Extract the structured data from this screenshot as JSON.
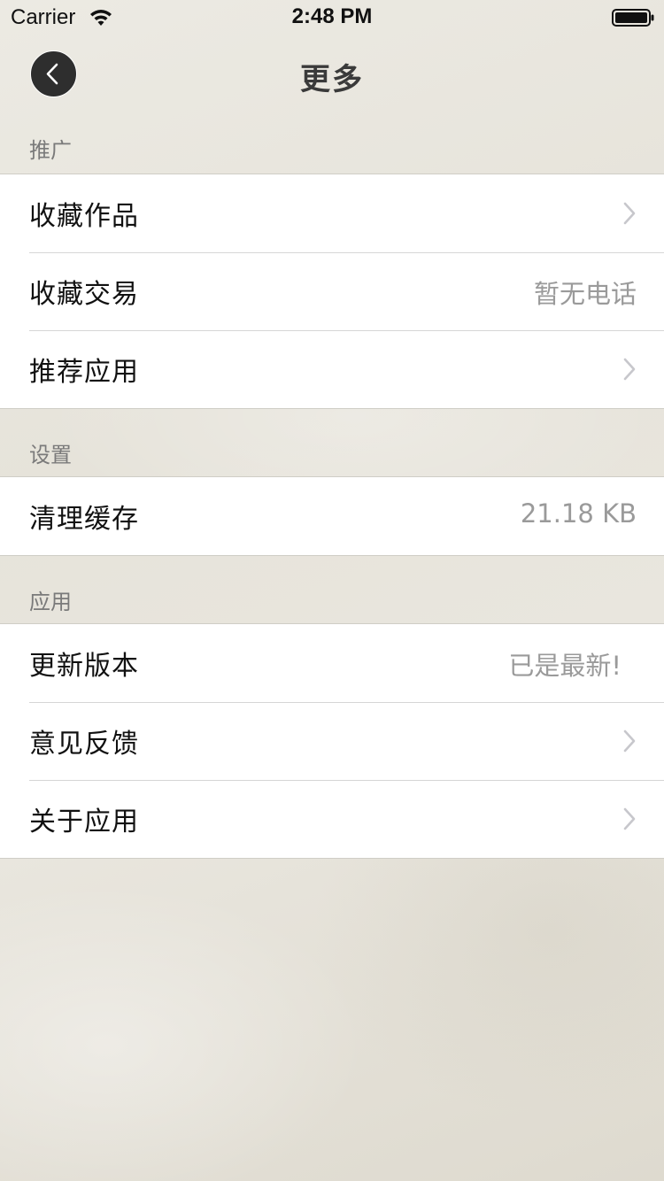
{
  "status_bar": {
    "carrier": "Carrier",
    "time": "2:48 PM",
    "wifi_icon": "wifi-icon",
    "battery_icon": "battery-full-icon"
  },
  "nav": {
    "title": "更多",
    "back_icon": "chevron-left-icon"
  },
  "sections": [
    {
      "header": "推广",
      "rows": [
        {
          "label": "收藏作品",
          "detail": null,
          "accessory": "chevron-right-icon"
        },
        {
          "label": "收藏交易",
          "detail": "暂无电话",
          "accessory": null
        },
        {
          "label": "推荐应用",
          "detail": null,
          "accessory": "chevron-right-icon"
        }
      ]
    },
    {
      "header": "设置",
      "rows": [
        {
          "label": "清理缓存",
          "detail": "21.18 KB",
          "accessory": null
        }
      ]
    },
    {
      "header": "应用",
      "rows": [
        {
          "label": "更新版本",
          "detail": "已是最新!",
          "accessory": null
        },
        {
          "label": "意见反馈",
          "detail": null,
          "accessory": "chevron-right-icon"
        },
        {
          "label": "关于应用",
          "detail": null,
          "accessory": "chevron-right-icon"
        }
      ]
    }
  ],
  "colors": {
    "accent_dark": "#2e2e2e",
    "detail_gray": "#9a9a9a",
    "section_header_gray": "#7a7a7a",
    "separator": "#d6d6d6"
  }
}
